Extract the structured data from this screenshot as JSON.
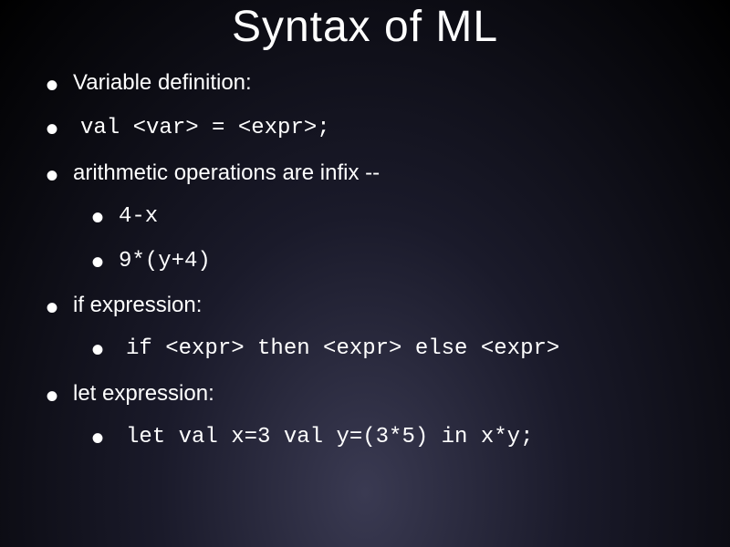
{
  "title": "Syntax of ML",
  "bullets": {
    "b0": "Variable definition:",
    "b1_code": "val <var> = <expr>;",
    "b2": "arithmetic operations are infix --",
    "b2_sub0": "4-x",
    "b2_sub1": "9*(y+4)",
    "b3": "if expression:",
    "b3_sub0": "if <expr> then <expr> else <expr>",
    "b4": "let expression:",
    "b4_sub0": "let val x=3 val y=(3*5) in x*y;"
  }
}
